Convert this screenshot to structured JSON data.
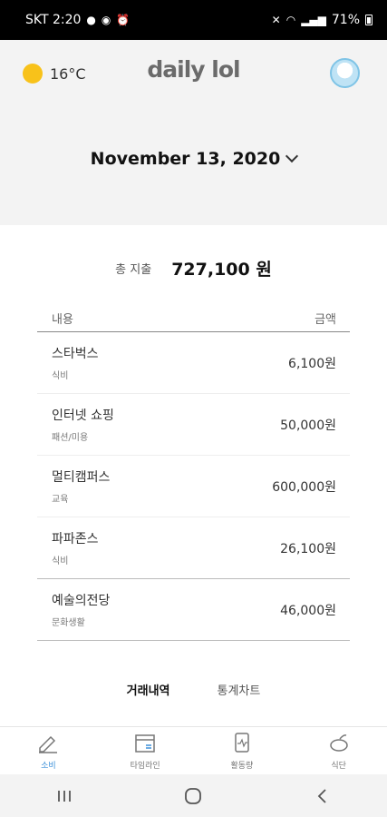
{
  "status_bar": {
    "carrier_time": "SKT 2:20",
    "battery": "71%"
  },
  "header": {
    "temperature": "16°C",
    "logo": "daily lol",
    "date": "November 13, 2020"
  },
  "summary": {
    "total_label": "총 지출",
    "total_value": "727,100 원"
  },
  "table": {
    "col_content": "내용",
    "col_amount": "금액",
    "rows": [
      {
        "name": "스타벅스",
        "category": "식비",
        "amount": "6,100원"
      },
      {
        "name": "인터넷 쇼핑",
        "category": "패션/미용",
        "amount": "50,000원"
      },
      {
        "name": "멀티캠퍼스",
        "category": "교육",
        "amount": "600,000원"
      },
      {
        "name": "파파존스",
        "category": "식비",
        "amount": "26,100원"
      },
      {
        "name": "예술의전당",
        "category": "문화생활",
        "amount": "46,000원"
      }
    ]
  },
  "tabs": {
    "transactions": "거래내역",
    "stats": "통계차트"
  },
  "bottom_nav": {
    "items": [
      {
        "label": "소비",
        "icon": "pencil-icon"
      },
      {
        "label": "타임라인",
        "icon": "calendar-icon"
      },
      {
        "label": "활동량",
        "icon": "activity-icon"
      },
      {
        "label": "식단",
        "icon": "food-icon"
      }
    ],
    "active_color": "#3a8fd9"
  },
  "colors": {
    "sun": "#f8c21a",
    "accent": "#3a8fd9"
  }
}
